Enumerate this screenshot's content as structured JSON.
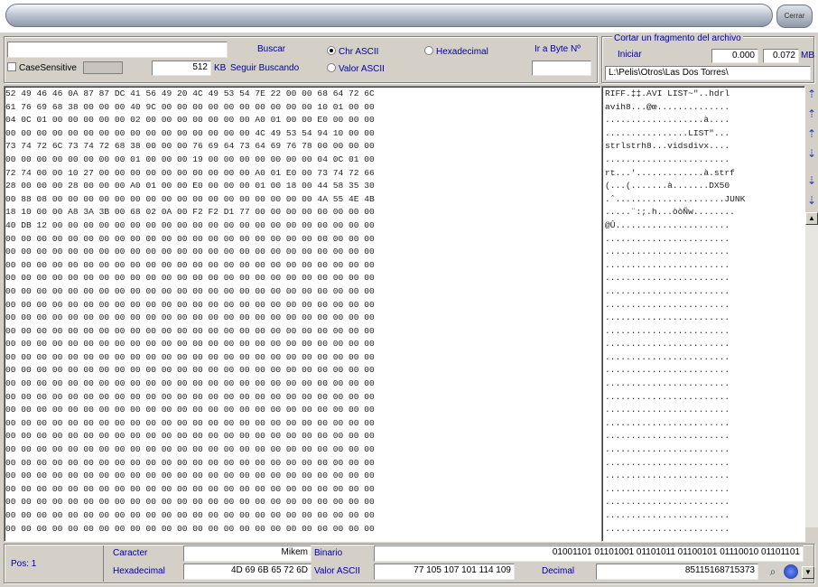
{
  "window": {
    "close_label": "Cerrar"
  },
  "search": {
    "query": "",
    "case_sensitive_label": "CaseSensitive",
    "size_value": "512",
    "size_unit": "KB",
    "find_button": "Buscar",
    "find_next_button": "Seguir Buscando",
    "mode_options": [
      "Chr ASCII",
      "Hexadecimal",
      "Valor ASCII"
    ],
    "mode_selected": "Chr ASCII",
    "goto_byte_label": "Ir a Byte Nº",
    "goto_byte_value": ""
  },
  "fragment": {
    "title": "Cortar un fragmento del archivo",
    "start_label": "Iniciar",
    "start_value": "0.000",
    "end_value": "0.072",
    "unit": "MB",
    "path": "L:\\Pelis\\Otros\\Las Dos Torres\\"
  },
  "hex_rows": [
    "52 49 46 46 0A 87 87 DC 41 56 49 20 4C 49 53 54 7E 22 00 00 68 64 72 6C",
    "61 76 69 68 38 00 00 00 40 9C 00 00 00 00 00 00 00 00 00 00 10 01 00 00",
    "04 0C 01 00 00 00 00 00 02 00 00 00 00 00 00 00 A0 01 00 00 E0 00 00 00",
    "00 00 00 00 00 00 00 00 00 00 00 00 00 00 00 00 4C 49 53 54 94 10 00 00",
    "73 74 72 6C 73 74 72 68 38 00 00 00 76 69 64 73 64 69 76 78 00 00 00 00",
    "00 00 00 00 00 00 00 00 01 00 00 00 19 00 00 00 00 00 00 00 04 0C 01 00",
    "72 74 00 00 10 27 00 00 00 00 00 00 00 00 00 00 A0 01 E0 00 73 74 72 66",
    "28 00 00 00 28 00 00 00 A0 01 00 00 E0 00 00 00 01 00 18 00 44 58 35 30",
    "00 88 08 00 00 00 00 00 00 00 00 00 00 00 00 00 00 00 00 00 4A 55 4E 4B",
    "18 10 00 00 A8 3A 3B 00 68 02 0A 00 F2 F2 D1 77 00 00 00 00 00 00 00 00",
    "40 DB 12 00 00 00 00 00 00 00 00 00 00 00 00 00 00 00 00 00 00 00 00 00",
    "00 00 00 00 00 00 00 00 00 00 00 00 00 00 00 00 00 00 00 00 00 00 00 00",
    "00 00 00 00 00 00 00 00 00 00 00 00 00 00 00 00 00 00 00 00 00 00 00 00",
    "00 00 00 00 00 00 00 00 00 00 00 00 00 00 00 00 00 00 00 00 00 00 00 00",
    "00 00 00 00 00 00 00 00 00 00 00 00 00 00 00 00 00 00 00 00 00 00 00 00",
    "00 00 00 00 00 00 00 00 00 00 00 00 00 00 00 00 00 00 00 00 00 00 00 00",
    "00 00 00 00 00 00 00 00 00 00 00 00 00 00 00 00 00 00 00 00 00 00 00 00",
    "00 00 00 00 00 00 00 00 00 00 00 00 00 00 00 00 00 00 00 00 00 00 00 00",
    "00 00 00 00 00 00 00 00 00 00 00 00 00 00 00 00 00 00 00 00 00 00 00 00",
    "00 00 00 00 00 00 00 00 00 00 00 00 00 00 00 00 00 00 00 00 00 00 00 00",
    "00 00 00 00 00 00 00 00 00 00 00 00 00 00 00 00 00 00 00 00 00 00 00 00",
    "00 00 00 00 00 00 00 00 00 00 00 00 00 00 00 00 00 00 00 00 00 00 00 00",
    "00 00 00 00 00 00 00 00 00 00 00 00 00 00 00 00 00 00 00 00 00 00 00 00",
    "00 00 00 00 00 00 00 00 00 00 00 00 00 00 00 00 00 00 00 00 00 00 00 00",
    "00 00 00 00 00 00 00 00 00 00 00 00 00 00 00 00 00 00 00 00 00 00 00 00",
    "00 00 00 00 00 00 00 00 00 00 00 00 00 00 00 00 00 00 00 00 00 00 00 00",
    "00 00 00 00 00 00 00 00 00 00 00 00 00 00 00 00 00 00 00 00 00 00 00 00",
    "00 00 00 00 00 00 00 00 00 00 00 00 00 00 00 00 00 00 00 00 00 00 00 00",
    "00 00 00 00 00 00 00 00 00 00 00 00 00 00 00 00 00 00 00 00 00 00 00 00",
    "00 00 00 00 00 00 00 00 00 00 00 00 00 00 00 00 00 00 00 00 00 00 00 00",
    "00 00 00 00 00 00 00 00 00 00 00 00 00 00 00 00 00 00 00 00 00 00 00 00",
    "00 00 00 00 00 00 00 00 00 00 00 00 00 00 00 00 00 00 00 00 00 00 00 00",
    "00 00 00 00 00 00 00 00 00 00 00 00 00 00 00 00 00 00 00 00 00 00 00 00",
    "00 00 00 00 00 00 00 00 00 00 00 00 00 00 00 00 00 00 00 00 00 00 00 00"
  ],
  "ascii_rows": [
    "RIFF.‡‡.AVI LIST~\"..hdrl",
    "avih8...@œ..............",
    "...................à....",
    "................LIST\"...",
    "strlstrh8...vidsdivx....",
    "........................",
    "rt...'.............à.strf",
    "(...(.......à.......DX50",
    ".ˆ.....................JUNK",
    ".....¨:;.h...òòÑw........",
    "@Û......................",
    "........................",
    "........................",
    "........................",
    "........................",
    "........................",
    "........................",
    "........................",
    "........................",
    "........................",
    "........................",
    "........................",
    "........................",
    "........................",
    "........................",
    "........................",
    "........................",
    "........................",
    "........................",
    "........................",
    "........................",
    "........................",
    "........................",
    "........................"
  ],
  "status": {
    "pos_label": "Pos: 1",
    "char_label": "Caracter",
    "char_value": "Mikem",
    "hex_label": "Hexadecimal",
    "hex_value": "4D 69 6B 65 72 6D",
    "binary_label": "Binario",
    "binary_value": "01001101 01101001 01101011 01100101 01110010 01101101",
    "ascii_label": "Valor ASCII",
    "ascii_value": "77 105 107 101 114 109",
    "decimal_label": "Decimal",
    "decimal_value": "85115168715373"
  }
}
